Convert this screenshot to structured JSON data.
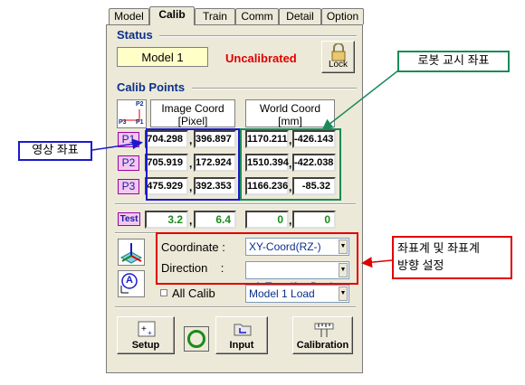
{
  "tabs": [
    "Model",
    "Calib",
    "Train",
    "Comm",
    "Detail",
    "Option"
  ],
  "status": {
    "title": "Status",
    "model": "Model 1",
    "state": "Uncalibrated",
    "lock_label": "Lock"
  },
  "calib": {
    "title": "Calib Points",
    "icon_labels": {
      "p2": "P2",
      "p3": "P3",
      "p1": "P1"
    },
    "image_header": [
      "Image Coord",
      "[Pixel]"
    ],
    "world_header": [
      "World Coord",
      "[mm]"
    ],
    "points": [
      {
        "label": "P1",
        "img_x": "704.298",
        "img_y": "396.897",
        "world_x": "1170.211",
        "world_y": "-426.143"
      },
      {
        "label": "P2",
        "img_x": "705.919",
        "img_y": "172.924",
        "world_x": "1510.394",
        "world_y": "-422.038"
      },
      {
        "label": "P3",
        "img_x": "475.929",
        "img_y": "392.353",
        "world_x": "1166.236",
        "world_y": "-85.32"
      }
    ],
    "test": {
      "label": "Test",
      "img_x": "3.2",
      "img_y": "6.4",
      "world_x": "0",
      "world_y": "0"
    },
    "comma": ","
  },
  "settings": {
    "coordinate_label": "Coordinate :",
    "coordinate_value": "XY-Coord(RZ-)",
    "direction_label": "Direction    :",
    "direction_value": "A-Type(0    Deg)",
    "all_calib_label": "All Calib",
    "load_value": "Model 1 Load",
    "icon_a": "A"
  },
  "buttons": {
    "setup": "Setup",
    "input": "Input",
    "calibration": "Calibration"
  },
  "annotations": {
    "robot_coord": "로봇 교시 좌표",
    "image_coord": "영상 좌표",
    "coord_direction": [
      "좌표계 및 좌표계",
      "방향 설정"
    ]
  },
  "colors": {
    "blue_box": "#1a1acc",
    "green_box": "#1a8a5a",
    "red_box": "#e00000",
    "title_blue": "#0b2f8c"
  }
}
